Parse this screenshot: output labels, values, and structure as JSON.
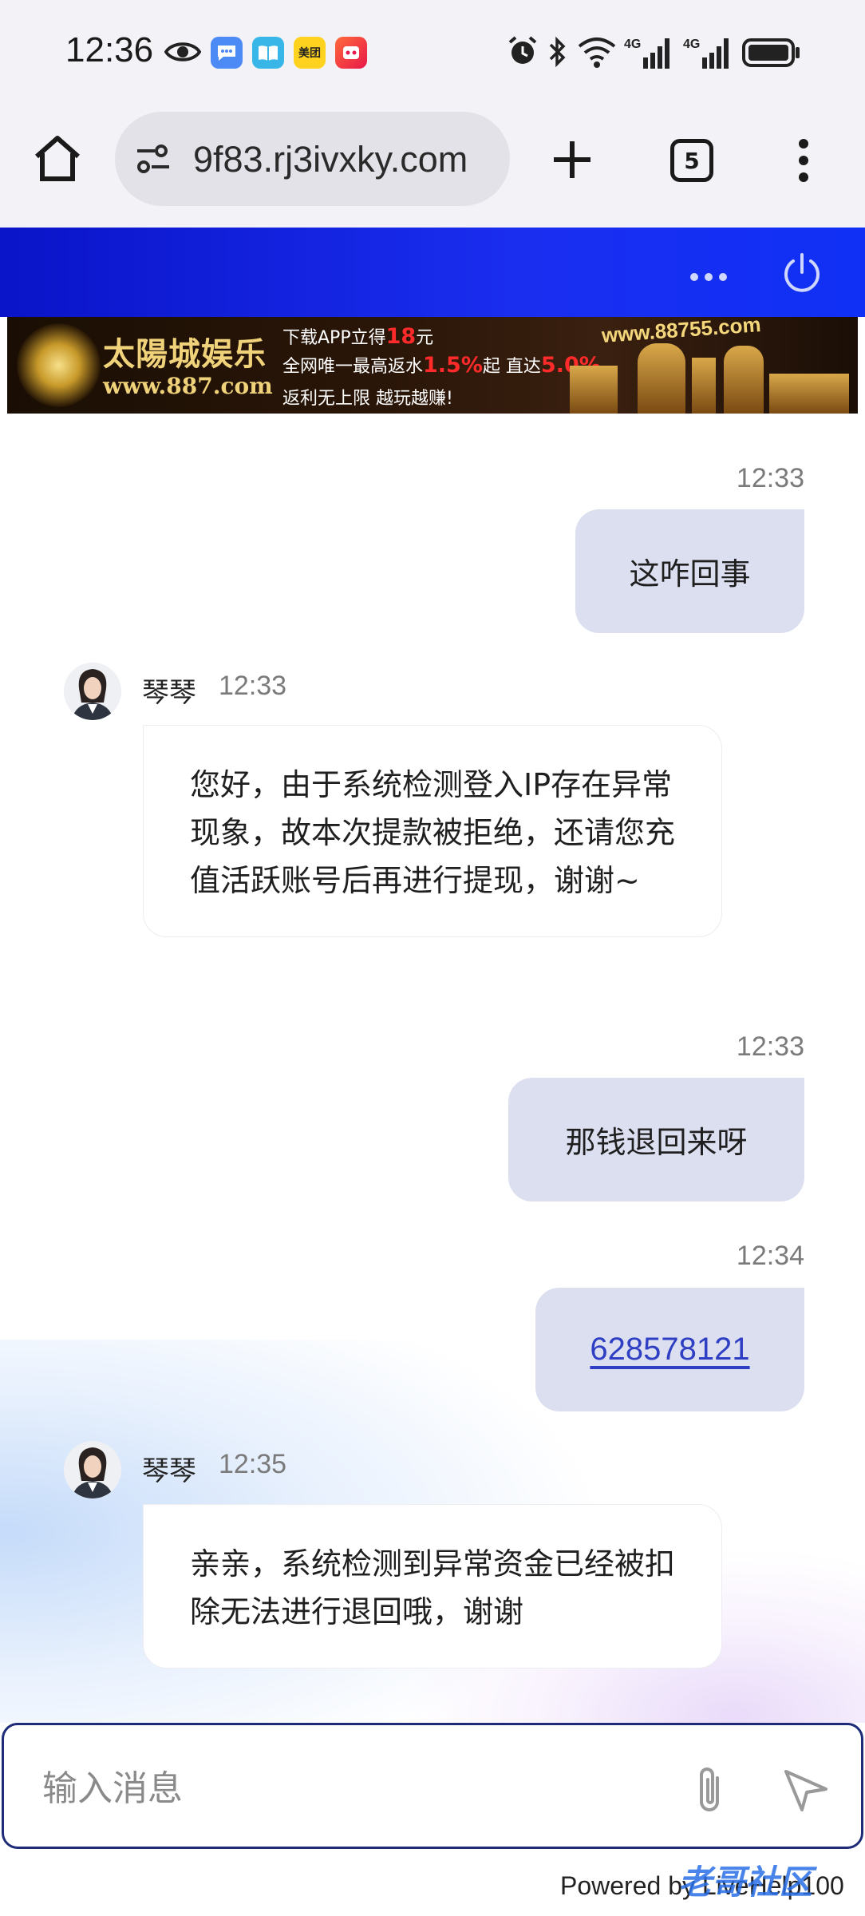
{
  "status_bar": {
    "time": "12:36",
    "app_icons": [
      "eye-icon",
      "chat-app-icon",
      "book-app-icon",
      "meituan-app-icon",
      "game-app-icon"
    ],
    "meituan_label": "美团",
    "system_icons": [
      "alarm-icon",
      "bluetooth-icon",
      "wifi-icon",
      "signal-4g-icon",
      "signal-4g-icon",
      "battery-icon"
    ],
    "network_label_1": "4G",
    "network_label_2": "4G"
  },
  "browser": {
    "url": "9f83.rj3ivxky.com",
    "tab_count": "5"
  },
  "banner": {
    "logo": "太陽城娱乐",
    "logo_url": "www.887.com",
    "line1_prefix": "下载APP立得",
    "line1_highlight": "18",
    "line1_suffix": "元",
    "line2_prefix": "全网唯一最高返水",
    "line2_highlight1": "1.5%",
    "line2_mid": "起 直达",
    "line2_highlight2": "5.0%",
    "line3": "返利无上限 越玩越赚!",
    "site_url": "www.88755.com"
  },
  "messages": [
    {
      "sender": "me",
      "time": "12:33",
      "text": "这咋回事"
    },
    {
      "sender": "agent",
      "name": "琴琴",
      "time": "12:33",
      "text": "您好，由于系统检测登入IP存在异常现象，故本次提款被拒绝，还请您充值活跃账号后再进行提现，谢谢~"
    },
    {
      "sender": "me",
      "time": "12:33",
      "text": "那钱退回来呀"
    },
    {
      "sender": "me",
      "time": "12:34",
      "text": "628578121"
    },
    {
      "sender": "agent",
      "name": "琴琴",
      "time": "12:35",
      "text": "亲亲，系统检测到异常资金已经被扣除无法进行退回哦，谢谢"
    }
  ],
  "input": {
    "placeholder": "输入消息"
  },
  "footer": {
    "powered_by": "Powered by LiveHelp100",
    "watermark": "老哥社区"
  },
  "colors": {
    "header_blue": "#1a2ef0",
    "my_bubble": "#dcdff0",
    "link": "#2e3fc4",
    "input_border": "#1e2b78"
  }
}
